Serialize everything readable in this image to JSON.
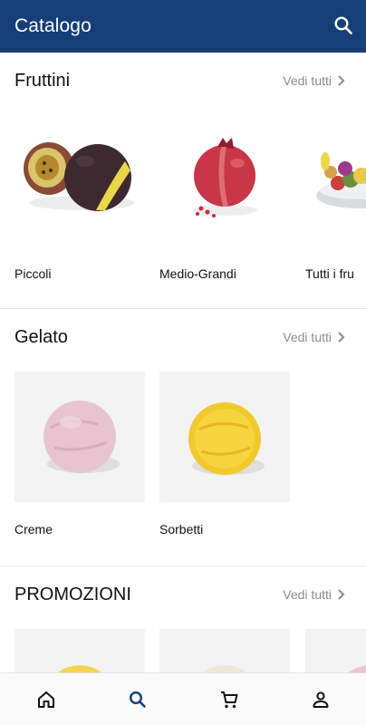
{
  "app_bar": {
    "title": "Catalogo",
    "icon": "search-icon",
    "background": "#163f78"
  },
  "sections": [
    {
      "title": "Fruttini",
      "see_all": "Vedi tutti",
      "items": [
        {
          "label": "Piccoli",
          "image": "passion-fruit-sorbet-photo"
        },
        {
          "label": "Medio-Grandi",
          "image": "pomegranate-sorbet-photo"
        },
        {
          "label": "Tutti i fru",
          "image": "fruit-bowl-photo"
        }
      ]
    },
    {
      "title": "Gelato",
      "see_all": "Vedi tutti",
      "items": [
        {
          "label": "Creme",
          "image": "pink-gelato-scoop-photo"
        },
        {
          "label": "Sorbetti",
          "image": "yellow-sorbet-scoop-photo"
        }
      ]
    },
    {
      "title": "PROMOZIONI",
      "see_all": "Vedi tutti",
      "items": [
        {
          "image": "yellow-scoop-photo"
        },
        {
          "image": "cream-scoop-photo"
        },
        {
          "image": "pink-scoop-photo"
        }
      ]
    }
  ],
  "bottom_nav": {
    "items": [
      "home-icon",
      "search-icon",
      "cart-icon",
      "account-icon"
    ],
    "active": "search-icon",
    "active_color": "#163f78"
  }
}
